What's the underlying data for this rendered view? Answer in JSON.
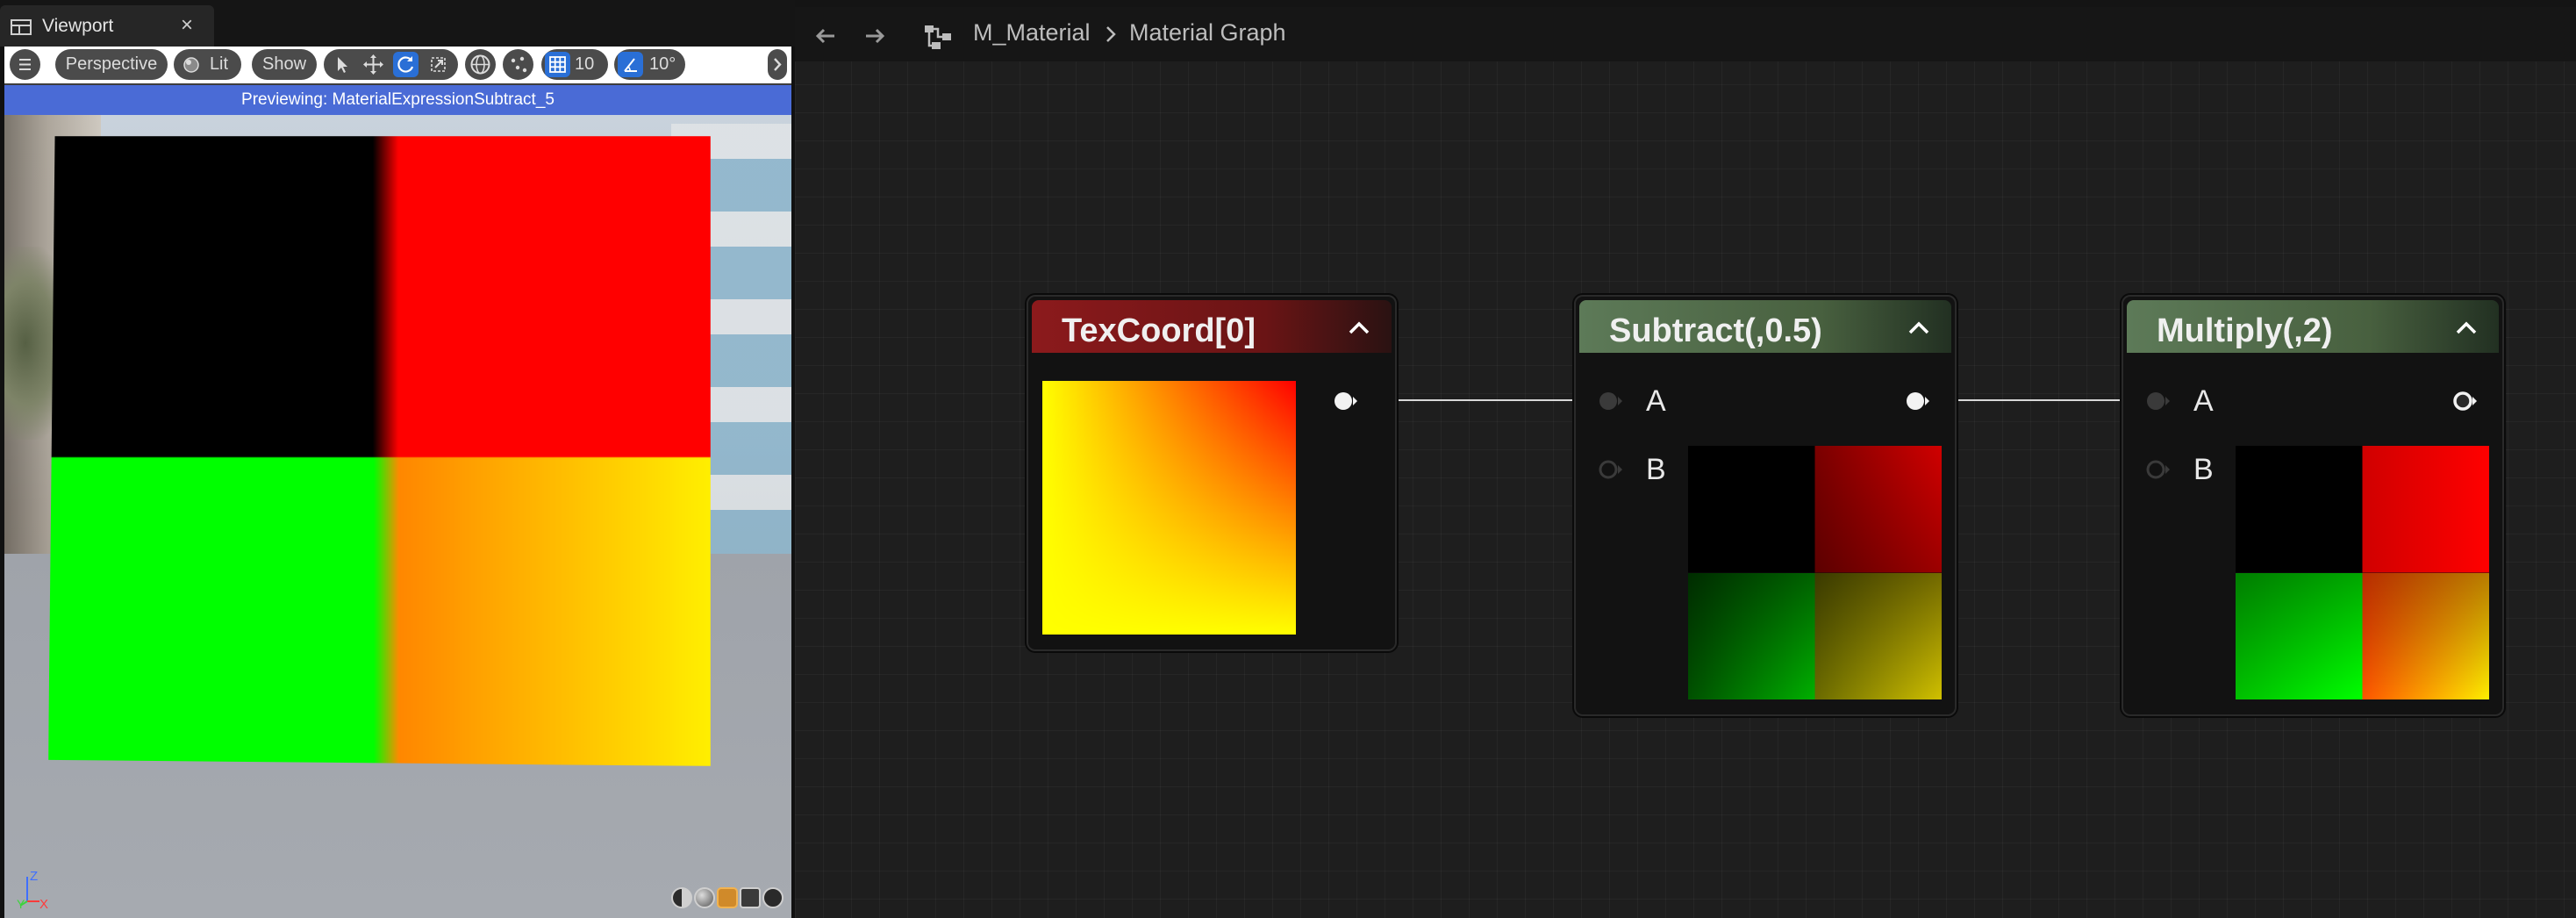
{
  "viewport": {
    "tab_label": "Viewport",
    "tab_close": "×",
    "toolbar": {
      "perspective_label": "Perspective",
      "lit_label": "Lit",
      "show_label": "Show",
      "grid_snap_value": "10",
      "rotation_snap_value": "10°"
    },
    "previewing_text": "Previewing: MaterialExpressionSubtract_5",
    "axis_labels": {
      "z": "Z",
      "y": "Y",
      "x": "X"
    }
  },
  "graph": {
    "breadcrumb": {
      "asset": "M_Material",
      "graph": "Material Graph"
    },
    "nodes": [
      {
        "title": "TexCoord[0]",
        "header_color": "#8c1a1c"
      },
      {
        "title": "Subtract(,0.5)",
        "header_color": "#5d7a58",
        "pin_a": "A",
        "pin_b": "B"
      },
      {
        "title": "Multiply(,2)",
        "header_color": "#5d7a58",
        "pin_a": "A",
        "pin_b": "B"
      }
    ]
  },
  "colors": {
    "accent_blue": "#2a6fd6",
    "preview_bar": "#4a6bd6",
    "graph_bg": "#1e1e1e"
  }
}
